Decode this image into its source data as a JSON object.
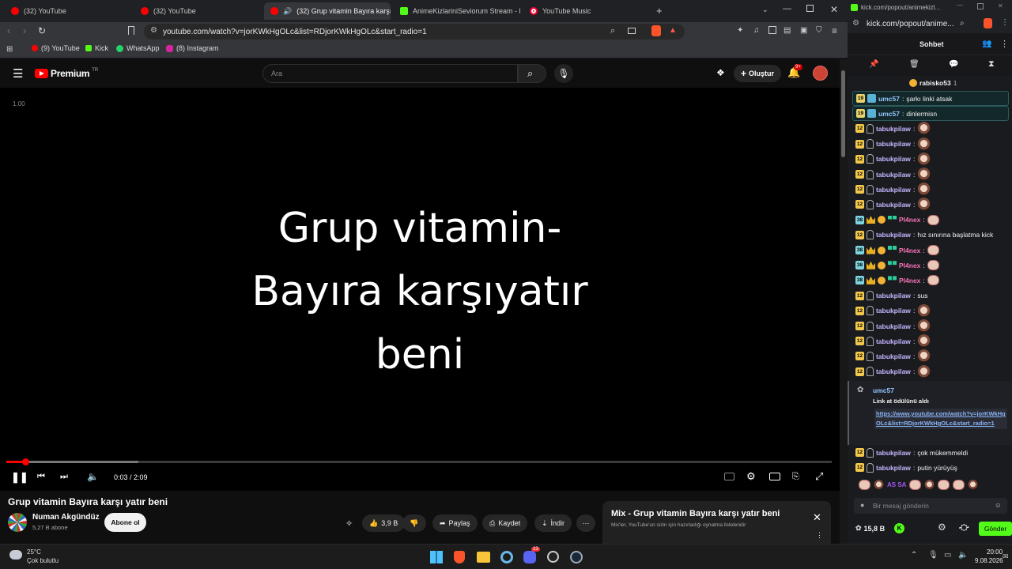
{
  "browser": {
    "tabs": [
      {
        "label": "(32) YouTube",
        "favicon": "youtube-icon"
      },
      {
        "label": "(32) YouTube",
        "favicon": "youtube-icon"
      },
      {
        "label": "(32) Grup vitamin Bayıra karşı",
        "favicon": "youtube-icon"
      },
      {
        "label": "AnimeKizlariniSeviorum Stream - Kic",
        "favicon": "kick-icon"
      },
      {
        "label": "YouTube Music",
        "favicon": "youtube-music-icon"
      }
    ],
    "url": "youtube.com/watch?v=jorKWkHgOLc&list=RDjorKWkHgOLc&start_radio=1",
    "bookmarks": [
      "(9) YouTube",
      "Kick",
      "WhatsApp",
      "(8) Instagram"
    ]
  },
  "youtube": {
    "logo_text": "Premium",
    "logo_sup": "TR",
    "search_placeholder": "Ara",
    "create_label": "Oluştur",
    "notif_count": "9+",
    "stats_overlay": "1.00",
    "lyric_lines": [
      "Grup vitamin-",
      "Bayıra karşıyatır",
      "beni"
    ],
    "progress": 0.023,
    "buffered": 0.16,
    "time": "0:03 / 2:09",
    "title": "Grup vitamin Bayıra karşı yatır beni",
    "channel": "Numan Akgündüz",
    "subscribers": "5,27 B abone",
    "subscribe_label": "Abone ol",
    "likes": "3,9 B",
    "share_label": "Paylaş",
    "save_label": "Kaydet",
    "download_label": "İndir",
    "mix_title": "Mix - Grup vitamin Bayıra karşı yatır beni",
    "mix_subtitle": "Mix'ler, YouTube'un sizin için hazırladığı oynatma listeleridir"
  },
  "kick": {
    "window_title": "kick.com/popout/animekizl...",
    "url": "kick.com/popout/anime...",
    "chat_title": "Sohbet",
    "top_user": "rabisko53",
    "top_count": "1",
    "messages": [
      {
        "badge": "19",
        "user": "umc57",
        "text": "şarkı linki atsak",
        "type": "text",
        "hl": true
      },
      {
        "badge": "19",
        "user": "umc57",
        "text": "dinlermisn",
        "type": "text",
        "hl": true
      },
      {
        "badge": "12",
        "user": "tabukpilaw",
        "text": "",
        "type": "emote"
      },
      {
        "badge": "12",
        "user": "tabukpilaw",
        "text": "",
        "type": "emote"
      },
      {
        "badge": "12",
        "user": "tabukpilaw",
        "text": "",
        "type": "emote"
      },
      {
        "badge": "12",
        "user": "tabukpilaw",
        "text": "",
        "type": "emote"
      },
      {
        "badge": "12",
        "user": "tabukpilaw",
        "text": "",
        "type": "emote"
      },
      {
        "badge": "12",
        "user": "tabukpilaw",
        "text": "",
        "type": "emote"
      },
      {
        "badge": "38",
        "user": "Pl4nex",
        "text": "",
        "type": "emote2"
      },
      {
        "badge": "12",
        "user": "tabukpilaw",
        "text": "hız sınırına başlatma kick",
        "type": "text"
      },
      {
        "badge": "38",
        "user": "Pl4nex",
        "text": "",
        "type": "emote2"
      },
      {
        "badge": "38",
        "user": "Pl4nex",
        "text": "",
        "type": "emote2"
      },
      {
        "badge": "38",
        "user": "Pl4nex",
        "text": "",
        "type": "emote2"
      },
      {
        "badge": "12",
        "user": "tabukpilaw",
        "text": "sus",
        "type": "text"
      },
      {
        "badge": "12",
        "user": "tabukpilaw",
        "text": "",
        "type": "emote"
      },
      {
        "badge": "12",
        "user": "tabukpilaw",
        "text": "",
        "type": "emote"
      },
      {
        "badge": "12",
        "user": "tabukpilaw",
        "text": "",
        "type": "emote"
      },
      {
        "badge": "12",
        "user": "tabukpilaw",
        "text": "",
        "type": "emote"
      },
      {
        "badge": "12",
        "user": "tabukpilaw",
        "text": "",
        "type": "emote"
      }
    ],
    "reward_user": "umc57",
    "reward_text": "Link at ödülünü aldı",
    "reward_link": "https://www.youtube.com/watch?v=jorKWkHgOLc&list=RDjorKWkHgOLc&start_radio=1",
    "after_messages": [
      {
        "badge": "12",
        "user": "tabukpilaw",
        "text": "çok mükemmeldi"
      },
      {
        "badge": "12",
        "user": "tabukpilaw",
        "text": "putin yürüyüş"
      }
    ],
    "emote_bar": "AS SA",
    "input_placeholder": "Bir mesaj gönderin",
    "points": "15,8 B",
    "send_label": "Gönder"
  },
  "taskbar": {
    "temp": "25°C",
    "weather": "Çok bulutlu",
    "time": "20:00",
    "date": "9.08.2026",
    "discord_badge": "23"
  },
  "colors": {
    "youtube_red": "#ff0000",
    "kick_green": "#53fc18"
  }
}
